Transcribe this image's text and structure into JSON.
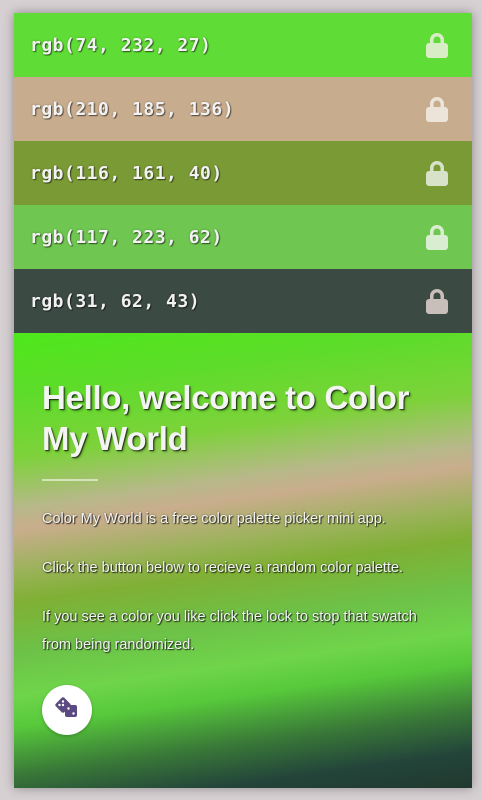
{
  "swatches": [
    {
      "label": "rgb(74, 232, 27)",
      "color": "#4ae81b",
      "icon": "lock-icon"
    },
    {
      "label": "rgb(210, 185, 136)",
      "color": "#d2b988",
      "icon": "lock-icon"
    },
    {
      "label": "rgb(116, 161, 40)",
      "color": "#74a128",
      "icon": "lock-icon"
    },
    {
      "label": "rgb(117, 223, 62)",
      "color": "#75df3e",
      "icon": "lock-icon"
    },
    {
      "label": "rgb(31, 62, 43)",
      "color": "#1f3e2b",
      "icon": "lock-icon"
    }
  ],
  "welcome": {
    "title": "Hello, welcome to Color My World",
    "paragraphs": [
      "Color My World is a free color palette picker mini app.",
      "Click the button below to recieve a random color palette.",
      "If you see a color you like click the lock to stop that swatch from being randomized."
    ],
    "button_icon": "dice-icon",
    "button_icon_color": "#5b4a82"
  }
}
